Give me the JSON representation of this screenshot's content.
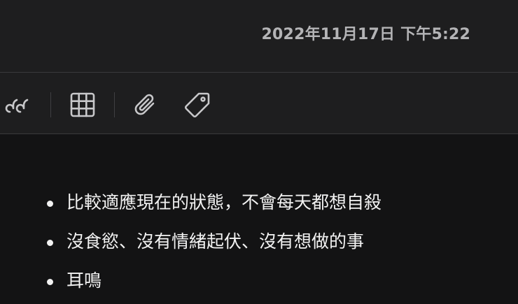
{
  "header": {
    "timestamp": "2022年11月17日 下午5:22"
  },
  "toolbar": {
    "tools": [
      {
        "name": "quote",
        "icon": "quote-icon"
      },
      {
        "name": "table",
        "icon": "table-icon"
      },
      {
        "name": "attachment",
        "icon": "paperclip-icon"
      },
      {
        "name": "tag",
        "icon": "tag-icon"
      }
    ],
    "icon_color": "#c8c8ca"
  },
  "note": {
    "items": [
      "比較適應現在的狀態，不會每天都想自殺",
      "沒食慾、沒有情緒起伏、沒有想做的事",
      "耳鳴"
    ]
  }
}
